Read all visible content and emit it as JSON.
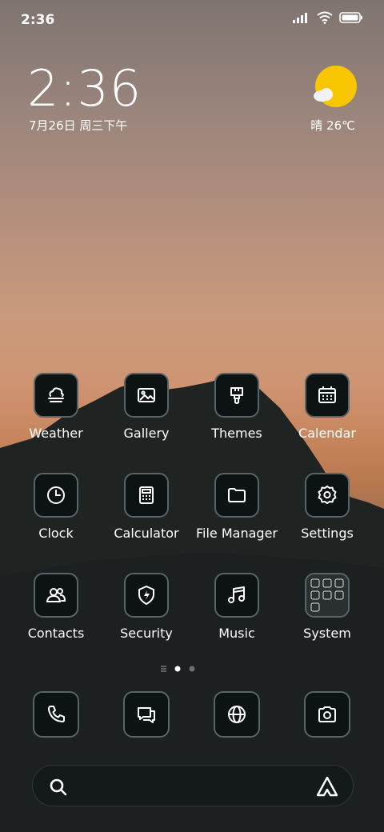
{
  "status_bar": {
    "time": "2:36"
  },
  "lock_clock": {
    "time": "2:36",
    "date": "7月26日 周三下午"
  },
  "weather": {
    "text": "晴 26℃",
    "sun_color": "#F7C600"
  },
  "apps": [
    {
      "label": "Weather"
    },
    {
      "label": "Gallery"
    },
    {
      "label": "Themes"
    },
    {
      "label": "Calendar"
    },
    {
      "label": "Clock"
    },
    {
      "label": "Calculator"
    },
    {
      "label": "File Manager"
    },
    {
      "label": "Settings"
    },
    {
      "label": "Contacts"
    },
    {
      "label": "Security"
    },
    {
      "label": "Music"
    },
    {
      "label": "System"
    }
  ],
  "page_indicator": {
    "pages": 2,
    "current": 1
  },
  "dock": [
    "phone-icon",
    "messages-icon",
    "browser-icon",
    "camera-icon"
  ],
  "colors": {
    "tile_bg": "#0D1213",
    "tile_border": "#5A6466",
    "icon_stroke": "#FFFFFF"
  }
}
